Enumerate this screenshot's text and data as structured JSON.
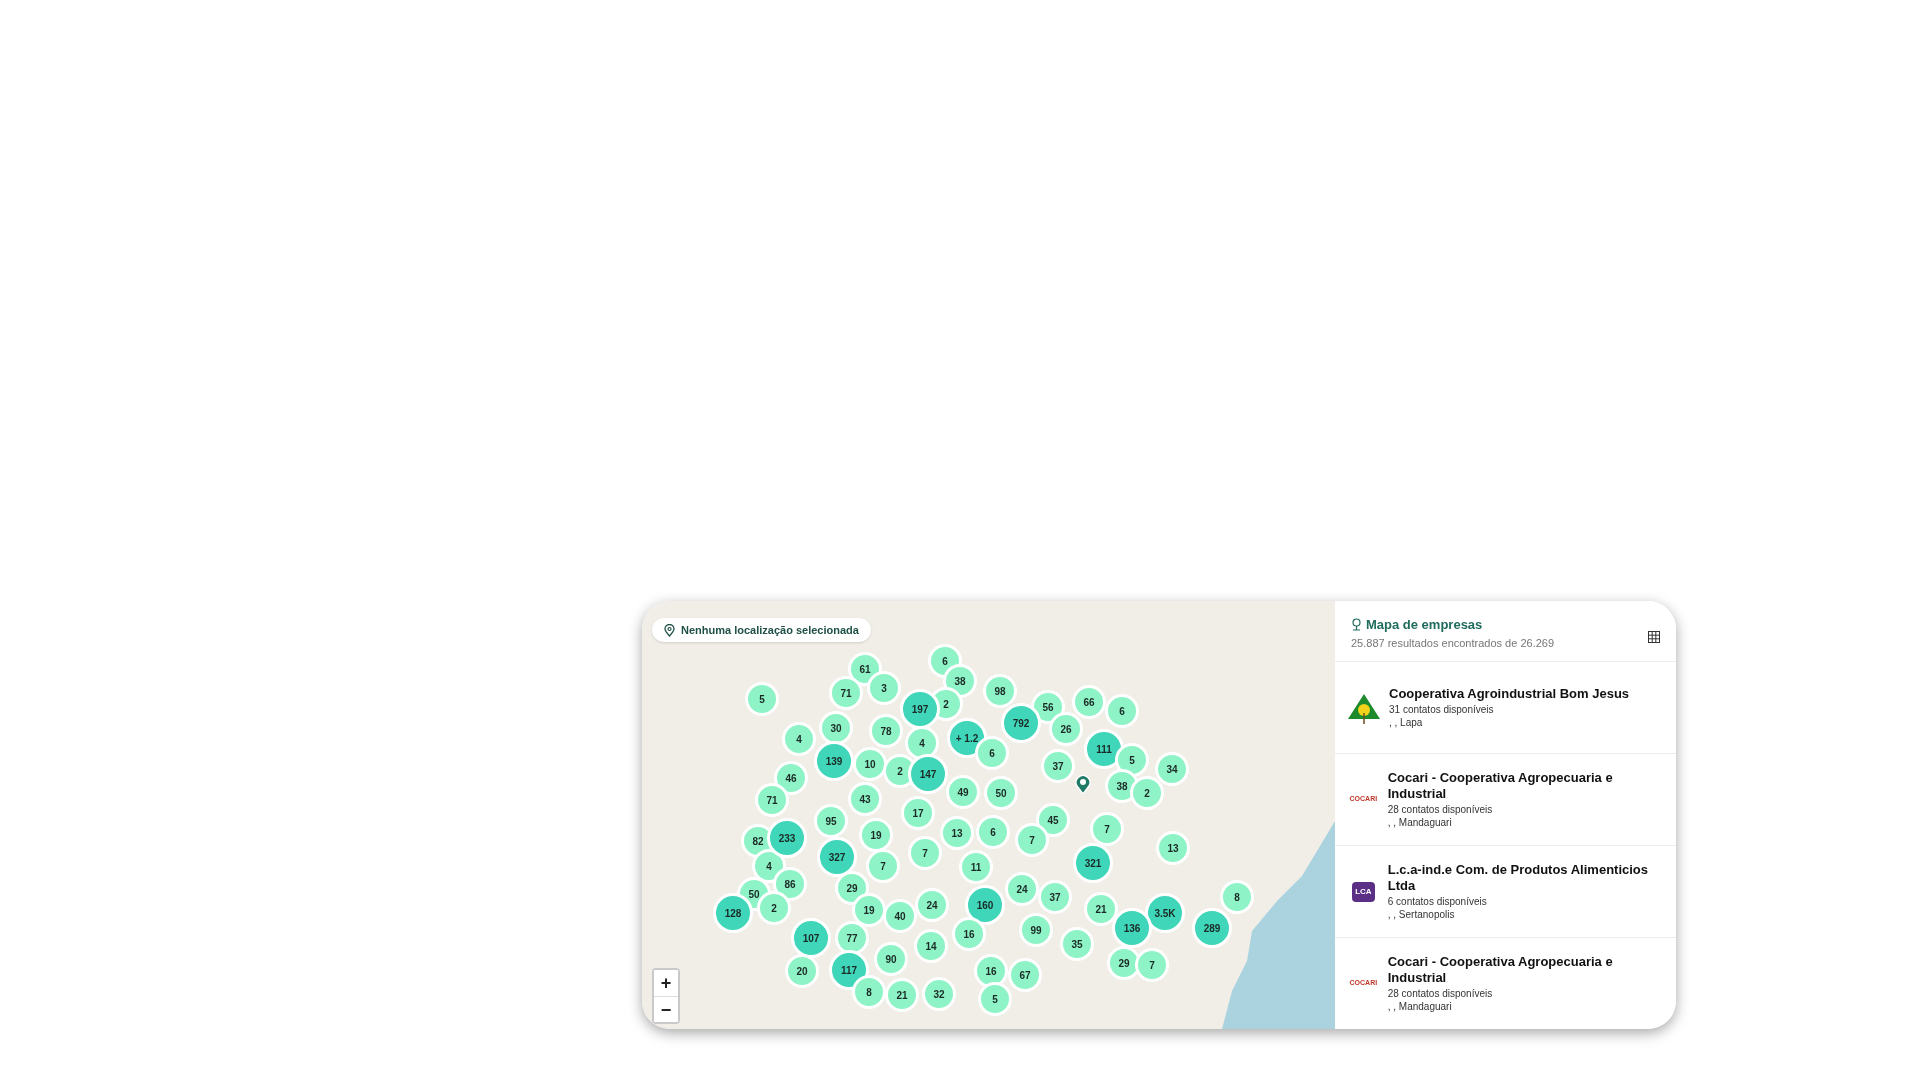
{
  "map": {
    "location_chip": "Nenhuma localização selecionada",
    "zoom_controls": [
      "+",
      "−"
    ],
    "clusters": [
      {
        "label": "6",
        "kind": "small"
      },
      {
        "label": "61",
        "kind": "small"
      },
      {
        "label": "38",
        "kind": "small"
      },
      {
        "label": "71",
        "kind": "small"
      },
      {
        "label": "3",
        "kind": "small"
      },
      {
        "label": "98",
        "kind": "small"
      },
      {
        "label": "5",
        "kind": "small"
      },
      {
        "label": "2",
        "kind": "small"
      },
      {
        "label": "197",
        "kind": "large"
      },
      {
        "label": "56",
        "kind": "small"
      },
      {
        "label": "66",
        "kind": "small"
      },
      {
        "label": "6",
        "kind": "small"
      },
      {
        "label": "792",
        "kind": "large"
      },
      {
        "label": "30",
        "kind": "small"
      },
      {
        "label": "78",
        "kind": "small"
      },
      {
        "label": "26",
        "kind": "small"
      },
      {
        "label": "4",
        "kind": "small"
      },
      {
        "label": "+ 1.2",
        "kind": "large"
      },
      {
        "label": "4",
        "kind": "small"
      },
      {
        "label": "46",
        "kind": "small"
      },
      {
        "label": "139",
        "kind": "large"
      },
      {
        "label": "10",
        "kind": "small"
      },
      {
        "label": "2",
        "kind": "small"
      },
      {
        "label": "147",
        "kind": "large"
      },
      {
        "label": "6",
        "kind": "small"
      },
      {
        "label": "37",
        "kind": "small"
      },
      {
        "label": "111",
        "kind": "large"
      },
      {
        "label": "5",
        "kind": "small"
      },
      {
        "label": "34",
        "kind": "small"
      },
      {
        "label": "71",
        "kind": "small"
      },
      {
        "label": "43",
        "kind": "small"
      },
      {
        "label": "49",
        "kind": "small"
      },
      {
        "label": "50",
        "kind": "small"
      },
      {
        "label": "38",
        "kind": "small"
      },
      {
        "label": "2",
        "kind": "small"
      },
      {
        "label": "95",
        "kind": "small"
      },
      {
        "label": "17",
        "kind": "small"
      },
      {
        "label": "45",
        "kind": "small"
      },
      {
        "label": "82",
        "kind": "small"
      },
      {
        "label": "4",
        "kind": "small"
      },
      {
        "label": "233",
        "kind": "large"
      },
      {
        "label": "327",
        "kind": "large"
      },
      {
        "label": "19",
        "kind": "small"
      },
      {
        "label": "7",
        "kind": "small"
      },
      {
        "label": "7",
        "kind": "small"
      },
      {
        "label": "13",
        "kind": "small"
      },
      {
        "label": "11",
        "kind": "small"
      },
      {
        "label": "6",
        "kind": "small"
      },
      {
        "label": "7",
        "kind": "small"
      },
      {
        "label": "321",
        "kind": "large"
      },
      {
        "label": "7",
        "kind": "small"
      },
      {
        "label": "13",
        "kind": "small"
      },
      {
        "label": "50",
        "kind": "small"
      },
      {
        "label": "86",
        "kind": "small"
      },
      {
        "label": "29",
        "kind": "small"
      },
      {
        "label": "24",
        "kind": "small"
      },
      {
        "label": "37",
        "kind": "small"
      },
      {
        "label": "8",
        "kind": "small"
      },
      {
        "label": "128",
        "kind": "large"
      },
      {
        "label": "2",
        "kind": "small"
      },
      {
        "label": "19",
        "kind": "small"
      },
      {
        "label": "40",
        "kind": "small"
      },
      {
        "label": "24",
        "kind": "small"
      },
      {
        "label": "160",
        "kind": "large"
      },
      {
        "label": "21",
        "kind": "small"
      },
      {
        "label": "3.5K",
        "kind": "large"
      },
      {
        "label": "107",
        "kind": "large"
      },
      {
        "label": "77",
        "kind": "small"
      },
      {
        "label": "16",
        "kind": "small"
      },
      {
        "label": "99",
        "kind": "small"
      },
      {
        "label": "136",
        "kind": "large"
      },
      {
        "label": "289",
        "kind": "large"
      },
      {
        "label": "14",
        "kind": "small"
      },
      {
        "label": "35",
        "kind": "small"
      },
      {
        "label": "20",
        "kind": "small"
      },
      {
        "label": "117",
        "kind": "large"
      },
      {
        "label": "90",
        "kind": "small"
      },
      {
        "label": "16",
        "kind": "small"
      },
      {
        "label": "67",
        "kind": "small"
      },
      {
        "label": "29",
        "kind": "small"
      },
      {
        "label": "7",
        "kind": "small"
      },
      {
        "label": "8",
        "kind": "small"
      },
      {
        "label": "21",
        "kind": "small"
      },
      {
        "label": "32",
        "kind": "small"
      },
      {
        "label": "5",
        "kind": "small"
      }
    ]
  },
  "panel": {
    "title": "Mapa de empresas",
    "subtitle": "25.887 resultados encontrados de 26.269",
    "companies": [
      {
        "kind": "tree",
        "name": "Cooperativa Agroindustrial Bom Jesus",
        "contacts": "31 contatos disponíveis",
        "location": ", , Lapa"
      },
      {
        "kind": "wordmark",
        "logo_text": "COCARI",
        "name": "Cocari - Cooperativa Agropecuaria e Industrial",
        "contacts": "28 contatos disponíveis",
        "location": ", , Mandaguari"
      },
      {
        "kind": "badge",
        "logo_text": "LCA",
        "name": "L.c.a-ind.e Com. de Produtos Alimenticios Ltda",
        "contacts": "6 contatos disponíveis",
        "location": ", , Sertanopolis"
      },
      {
        "kind": "wordmark",
        "logo_text": "COCARI",
        "name": "Cocari - Cooperativa Agropecuaria e Industrial",
        "contacts": "28 contatos disponíveis",
        "location": ", , Mandaguari"
      }
    ]
  }
}
